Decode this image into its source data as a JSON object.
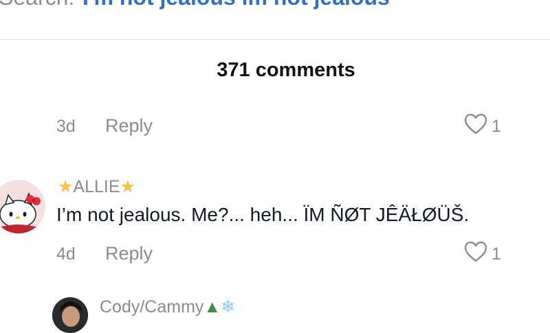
{
  "search": {
    "prefix": "Search:",
    "query": "I'm not jealous im not jealous"
  },
  "comments_header": {
    "count_label": "371 comments"
  },
  "comments": [
    {
      "time": "3d",
      "reply_label": "Reply",
      "likes": "1"
    },
    {
      "username": "ALLIE",
      "text": "I’m not jealous. Me?... heh... ÏM ÑØT JÊÄŁØÜŠ.",
      "time": "4d",
      "reply_label": "Reply",
      "likes": "1",
      "avatar": "hello-kitty-avatar"
    },
    {
      "username": "Cody/Cammy",
      "avatar": "person-avatar"
    }
  ],
  "colors": {
    "secondary_text": "#8a8b91",
    "primary_text": "#161823",
    "link": "#2f6fc7",
    "divider": "#e3e3e4",
    "star": "#f6c244"
  }
}
